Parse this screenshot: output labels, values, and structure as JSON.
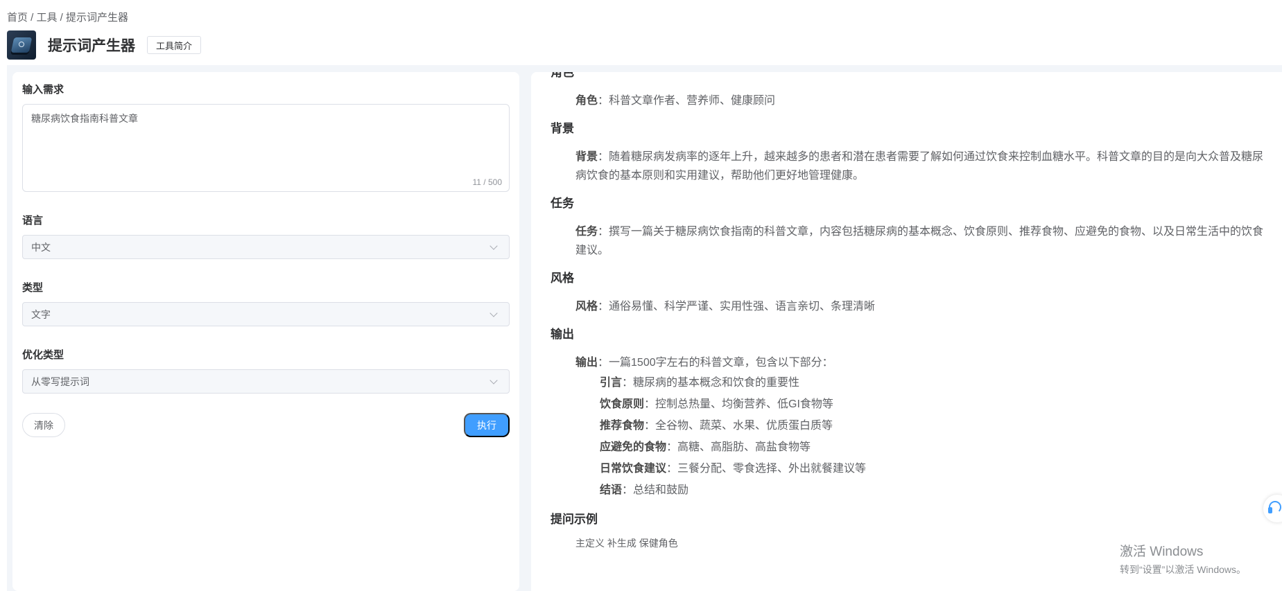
{
  "breadcrumb": "首页 / 工具 / 提示词产生器",
  "header": {
    "title": "提示词产生器",
    "intro_button": "工具简介"
  },
  "form": {
    "input_label": "输入需求",
    "input_value": "糖尿病饮食指南科普文章",
    "input_counter": "11 / 500",
    "language_label": "语言",
    "language_value": "中文",
    "type_label": "类型",
    "type_value": "文字",
    "opt_label": "优化类型",
    "opt_value": "从零写提示词",
    "clear_button": "清除",
    "run_button": "执行"
  },
  "result": {
    "role": {
      "title": "角色",
      "key": "角色",
      "text": "：科普文章作者、营养师、健康顾问"
    },
    "background": {
      "title": "背景",
      "key": "背景",
      "text": "：随着糖尿病发病率的逐年上升，越来越多的患者和潜在患者需要了解如何通过饮食来控制血糖水平。科普文章的目的是向大众普及糖尿病饮食的基本原则和实用建议，帮助他们更好地管理健康。"
    },
    "task": {
      "title": "任务",
      "key": "任务",
      "text": "：撰写一篇关于糖尿病饮食指南的科普文章，内容包括糖尿病的基本概念、饮食原则、推荐食物、应避免的食物、以及日常生活中的饮食建议。"
    },
    "style": {
      "title": "风格",
      "key": "风格",
      "text": "：通俗易懂、科学严谨、实用性强、语言亲切、条理清晰"
    },
    "output": {
      "title": "输出",
      "key": "输出",
      "text": "：一篇1500字左右的科普文章，包含以下部分：",
      "items": [
        {
          "key": "引言",
          "text": "：糖尿病的基本概念和饮食的重要性"
        },
        {
          "key": "饮食原则",
          "text": "：控制总热量、均衡营养、低GI食物等"
        },
        {
          "key": "推荐食物",
          "text": "：全谷物、蔬菜、水果、优质蛋白质等"
        },
        {
          "key": "应避免的食物",
          "text": "：高糖、高脂肪、高盐食物等"
        },
        {
          "key": "日常饮食建议",
          "text": "：三餐分配、零食选择、外出就餐建议等"
        },
        {
          "key": "结语",
          "text": "：总结和鼓励"
        }
      ]
    },
    "examples": {
      "title": "提问示例",
      "cut_text": "主定义 补生成 保健角色"
    }
  },
  "watermark": {
    "title": "激活 Windows",
    "subtitle": "转到“设置”以激活 Windows。"
  }
}
